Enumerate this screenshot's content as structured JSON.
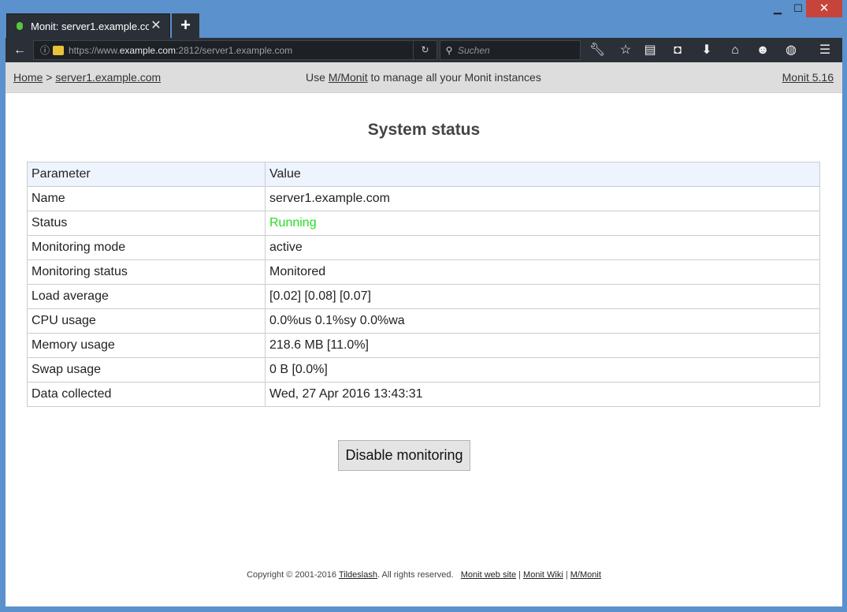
{
  "browser": {
    "tab_title": "Monit: server1.example.co...",
    "new_tab": "+",
    "url_prefix": "https://www.",
    "url_host": "example.com",
    "url_rest": ":2812/server1.example.com",
    "search_placeholder": "Suchen",
    "icons": [
      "back-icon",
      "info-icon",
      "lock-warning-icon",
      "reload-icon",
      "search-icon",
      "wrench-icon",
      "star-icon",
      "reader-icon",
      "pocket-icon",
      "download-icon",
      "home-icon",
      "smiley-icon",
      "globe-icon",
      "menu-icon"
    ]
  },
  "topbar": {
    "home": "Home",
    "separator": ">",
    "server": "server1.example.com",
    "use_text": "Use",
    "mmonit_link": "M/Monit",
    "manage_text": "to manage all your Monit instances",
    "version": "Monit 5.16"
  },
  "heading": "System status",
  "table": {
    "headers": [
      "Parameter",
      "Value"
    ],
    "rows": [
      {
        "param": "Name",
        "value": "server1.example.com"
      },
      {
        "param": "Status",
        "value": "Running"
      },
      {
        "param": "Monitoring mode",
        "value": "active"
      },
      {
        "param": "Monitoring status",
        "value": "Monitored"
      },
      {
        "param": "Load average",
        "value": "[0.02] [0.08] [0.07]"
      },
      {
        "param": "CPU usage",
        "value": "0.0%us 0.1%sy 0.0%wa"
      },
      {
        "param": "Memory usage",
        "value": "218.6 MB [11.0%]"
      },
      {
        "param": "Swap usage",
        "value": "0 B [0.0%]"
      },
      {
        "param": "Data collected",
        "value": "Wed, 27 Apr 2016 13:43:31"
      }
    ]
  },
  "button": "Disable monitoring",
  "footer": {
    "copyright": "Copyright © 2001-2016",
    "company": "Tildeslash",
    "rights": ". All rights reserved.",
    "website": "Monit web site",
    "wiki": "Monit Wiki",
    "mmonit": "M/Monit",
    "sep": "|"
  },
  "colors": {
    "status_running": "#22dd22",
    "table_header": "#eef4fd",
    "topbar": "#dddddd"
  }
}
